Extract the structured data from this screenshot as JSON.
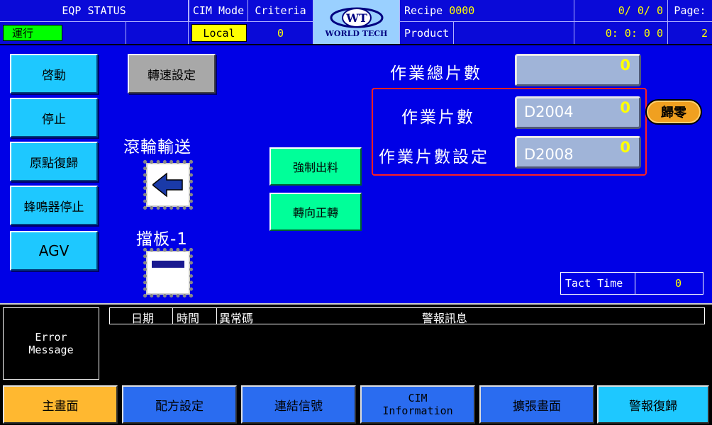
{
  "header": {
    "eqp_status_label": "EQP STATUS",
    "eqp_status_value": "運行",
    "cim_mode_label": "CIM Mode",
    "cim_mode_value": "Local",
    "criteria_label": "Criteria",
    "criteria_value": "0",
    "logo_text": "WORLD TECH",
    "recipe_label": "Recipe",
    "recipe_value": "0000",
    "product_label": "Product",
    "date_value": "0/ 0/ 0",
    "time_value": "0: 0: 0 0",
    "page_label": "Page:",
    "page_value": "2"
  },
  "left_buttons": [
    "啓動",
    "停止",
    "原點復歸",
    "蜂鳴器停止",
    "AGV"
  ],
  "speed_setting_button": "轉速設定",
  "roller_label": "滾輪輸送",
  "baffle_label": "擋板-1",
  "force_output_button": "強制出料",
  "reverse_button": "轉向正轉",
  "counters": {
    "total_label": "作業總片數",
    "total_value": "0",
    "count_label": "作業片數",
    "count_tag": "D2004",
    "count_value": "0",
    "setting_label": "作業片數設定",
    "setting_tag": "D2008",
    "setting_value": "0",
    "reset_button": "歸零"
  },
  "tact_time": {
    "label": "Tact Time",
    "value": "0"
  },
  "error_panel": {
    "title_line1": "Error",
    "title_line2": "Message",
    "col_date": "日期",
    "col_time": "時間",
    "col_code": "異常碼",
    "col_message": "警報訊息"
  },
  "nav": [
    "主畫面",
    "配方設定",
    "連結信號",
    "CIM\nInformation",
    "擴張畫面",
    "警報復歸"
  ],
  "colors": {
    "background": "#0000e6",
    "header": "#0a0ad8",
    "accent_yellow": "#ffff00",
    "button_cyan": "#1ec8ff",
    "button_green": "#00ff99",
    "highlight_red": "#ff2020"
  }
}
